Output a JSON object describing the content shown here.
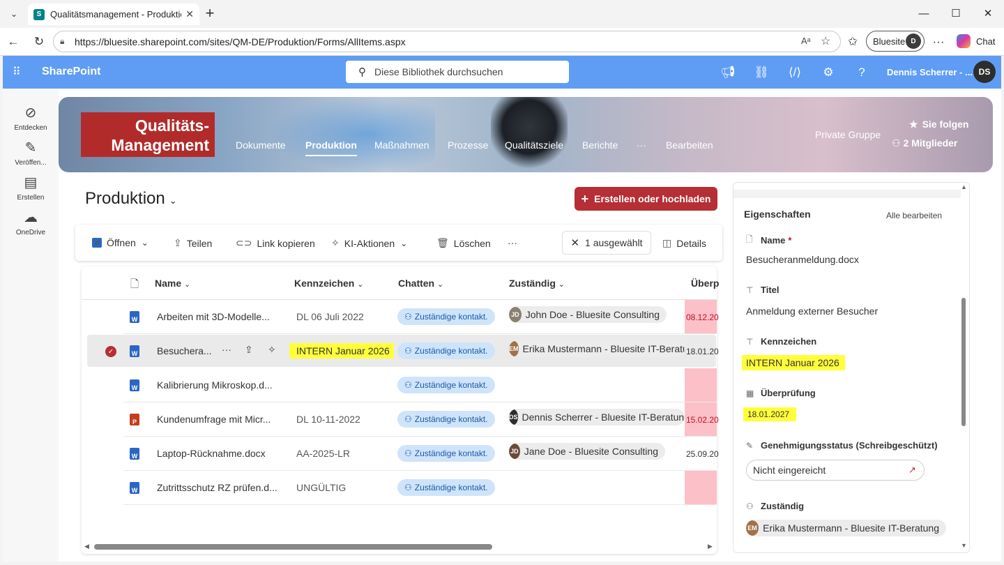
{
  "browser": {
    "tab_title": "Qualitätsmanagement - Produktion",
    "url": "https://bluesite.sharepoint.com/sites/QM-DE/Produktion/Forms/AllItems.aspx",
    "profile_label": "Bluesite",
    "chat_label": "Chat"
  },
  "suitebar": {
    "app_name": "SharePoint",
    "search_placeholder": "Diese Bibliothek durchsuchen",
    "user_name": "Dennis Scherrer - ..."
  },
  "rail": [
    {
      "label": "Entdecken",
      "icon": "compass-icon"
    },
    {
      "label": "Veröffen...",
      "icon": "pen-icon"
    },
    {
      "label": "Erstellen",
      "icon": "layout-icon"
    },
    {
      "label": "OneDrive",
      "icon": "cloud-icon"
    }
  ],
  "site": {
    "logo_line1": "Qualitäts-",
    "logo_line2": "Management",
    "nav": [
      "Dokumente",
      "Produktion",
      "Maßnahmen",
      "Prozesse",
      "Qualitätsziele",
      "Berichte",
      "···",
      "Bearbeiten"
    ],
    "private_group": "Private Gruppe",
    "follow": "Sie folgen",
    "members": "2 Mitglieder"
  },
  "library": {
    "title": "Produktion",
    "create_button": "Erstellen oder hochladen"
  },
  "commands": {
    "open": "Öffnen",
    "share": "Teilen",
    "copy_link": "Link kopieren",
    "ai_actions": "KI-Aktionen",
    "delete": "Löschen",
    "more": "···",
    "selected": "1 ausgewählt",
    "details": "Details"
  },
  "columns": [
    "Name",
    "Kennzeichen",
    "Chatten",
    "Zuständig",
    "Überp"
  ],
  "chat_pill": "Zuständige kontakt.",
  "rows": [
    {
      "name": "Arbeiten mit 3D-Modelle...",
      "type": "word",
      "kennzeichen": "DL 06 Juli 2022",
      "person": "John Doe - Bluesite Consulting",
      "date": "08.12.20",
      "date_style": "red"
    },
    {
      "name": "Besuchera...",
      "type": "word",
      "kennzeichen": "INTERN Januar 2026",
      "person": "Erika Mustermann - Bluesite IT-Beratu",
      "date": "18.01.20",
      "date_style": "plain"
    },
    {
      "name": "Kalibrierung Mikroskop.d...",
      "type": "word",
      "kennzeichen": "",
      "person": "",
      "date": "",
      "date_style": "red"
    },
    {
      "name": "Kundenumfrage mit Micr...",
      "type": "ppt",
      "kennzeichen": "DL 10-11-2022",
      "person": "Dennis Scherrer - Bluesite IT-Beratun",
      "date": "15.02.20",
      "date_style": "red"
    },
    {
      "name": "Laptop-Rücknahme.docx",
      "type": "word",
      "kennzeichen": "AA-2025-LR",
      "person": "Jane Doe - Bluesite Consulting",
      "date": "25.09.20",
      "date_style": "plain"
    },
    {
      "name": "Zutrittsschutz RZ prüfen.d...",
      "type": "word",
      "kennzeichen": "UNGÜLTIG",
      "person": "",
      "date": "",
      "date_style": "red"
    }
  ],
  "properties": {
    "heading": "Eigenschaften",
    "edit_all": "Alle bearbeiten",
    "name_label": "Name",
    "name_required": "*",
    "name_value": "Besucheranmeldung.docx",
    "title_label": "Titel",
    "title_value": "Anmeldung externer Besucher",
    "kz_label": "Kennzeichen",
    "kz_value": "INTERN Januar 2026",
    "review_label": "Überprüfung",
    "review_value": "18.01.2027",
    "approval_label": "Genehmigungsstatus (Schreibgeschützt)",
    "approval_value": "Nicht eingereicht",
    "owner_label": "Zuständig",
    "owner_value": "Erika Mustermann - Bluesite IT-Beratung"
  },
  "colors": {
    "suitebar": "#5f9df5",
    "create_button": "#b52f35",
    "logo": "#b22b2b",
    "highlight": "#ffff3c",
    "overdue": "#fcc0c8"
  }
}
